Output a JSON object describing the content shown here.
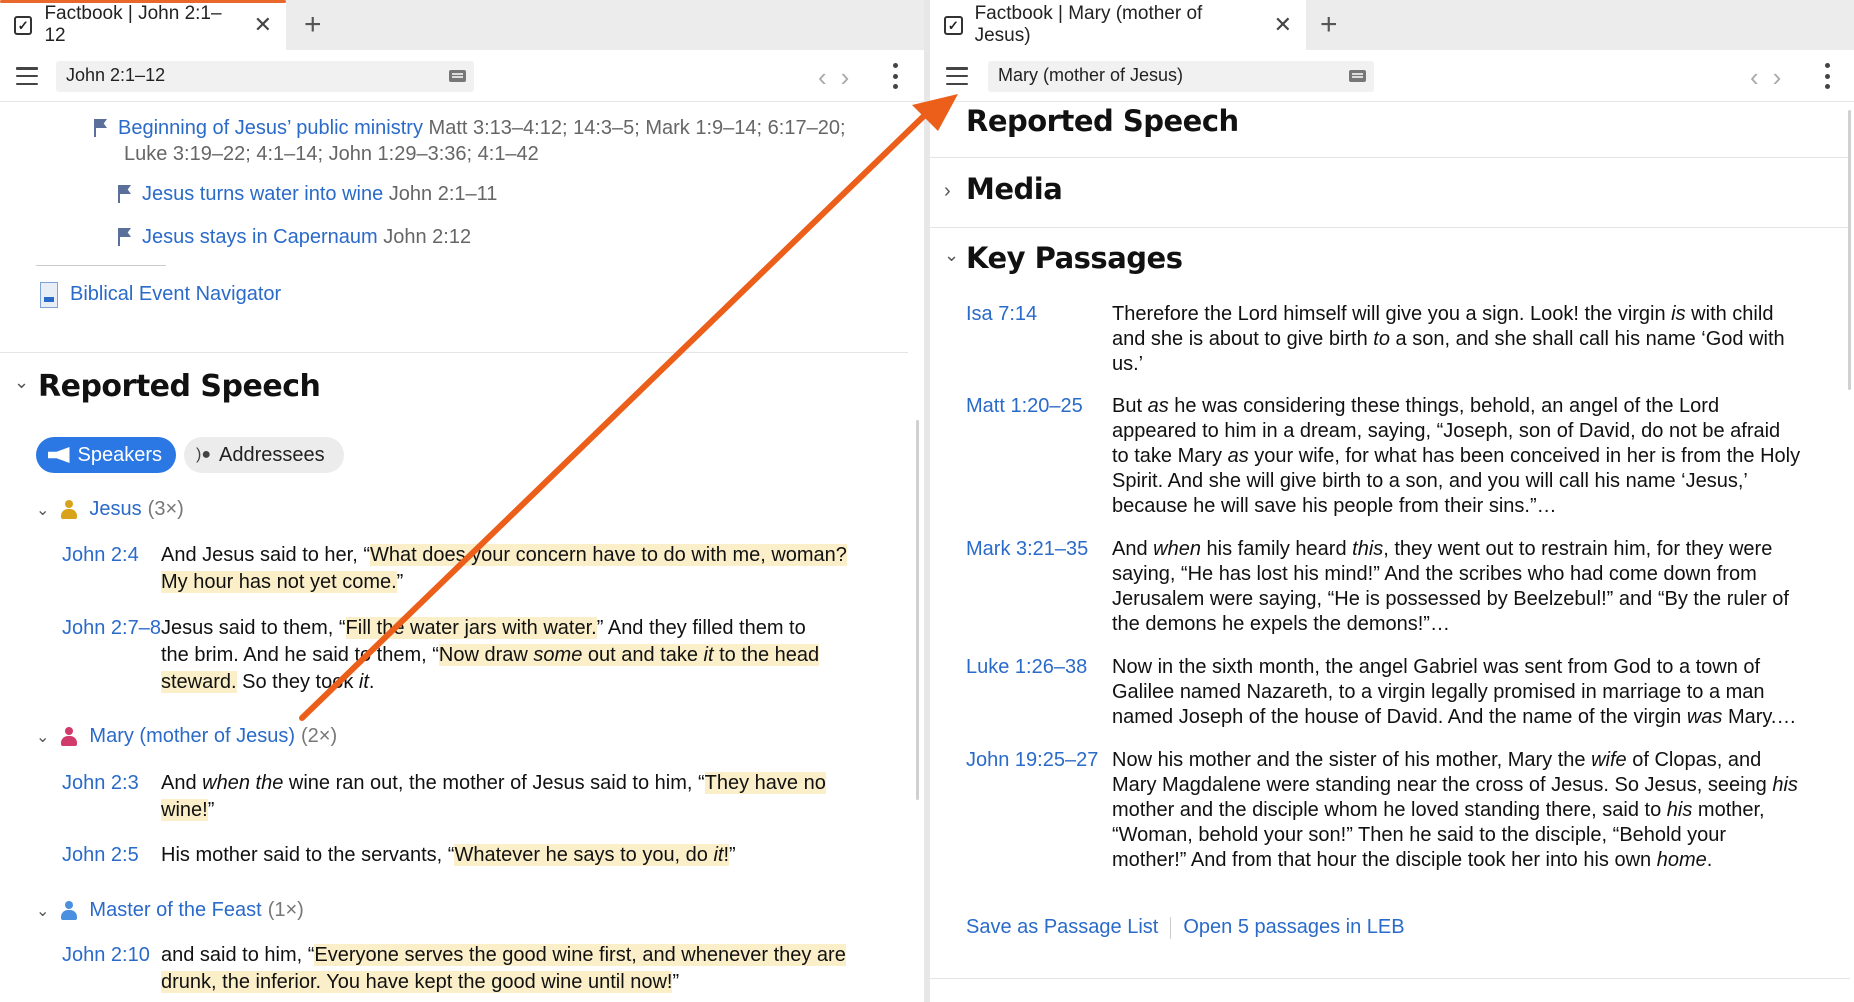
{
  "left": {
    "tab": {
      "title": "Factbook | John 2:1–12"
    },
    "toolbar": {
      "reference": "John 2:1–12"
    },
    "events": [
      {
        "title": "Beginning of Jesus’ public ministry",
        "refs_line1": "Matt 3:13–4:12; 14:3–5; Mark 1:9–14; 6:17–20;",
        "refs_line2": "Luke 3:19–22; 4:1–14; John 1:29–3:36; 4:1–42"
      },
      {
        "title": "Jesus turns water into wine",
        "refs": "John 2:1–11"
      },
      {
        "title": "Jesus stays in Capernaum",
        "refs": "John 2:12"
      }
    ],
    "navigator_link": "Biblical Event Navigator",
    "section_title": "Reported Speech",
    "pills": {
      "speakers": "Speakers",
      "addressees": "Addressees"
    },
    "speakers": [
      {
        "name": "Jesus",
        "count": "(3×)",
        "color": "#d9a21b"
      },
      {
        "name": "Mary (mother of Jesus)",
        "count": "(2×)",
        "color": "#d23a6b"
      },
      {
        "name": "Master of the Feast",
        "count": "(1×)",
        "color": "#4a8fe0"
      }
    ],
    "quotes": {
      "q1": {
        "ref": "John 2:4",
        "a": "And Jesus said to her, “",
        "h1": "What does your concern have to do with me, woman?",
        "h2": "My hour has not yet come.",
        "b": "”"
      },
      "q2": {
        "ref": "John 2:7–8",
        "a": "Jesus said to them, “",
        "h1": "Fill the water jars with water.",
        "b": "” And they filled them to",
        "c": "the brim. And he said to them, “",
        "h2a": "Now draw ",
        "h2b": "some",
        "h2c": " out and take ",
        "h2d": "it",
        "h2e": " to the head",
        "h3": "steward.",
        "d": " So they took ",
        "e": "it",
        "f": "."
      },
      "q3": {
        "ref": "John 2:3",
        "a": "And ",
        "a_i": "when the",
        "b": " wine ran out, the mother of Jesus said to him, “",
        "h1": "They have no",
        "h2": "wine!",
        "c": "”"
      },
      "q4": {
        "ref": "John 2:5",
        "a": "His mother said to the servants, “",
        "h1": "Whatever he says to you, do ",
        "h1_i": "it",
        "h1b": "!",
        "b": "”"
      },
      "q5": {
        "ref": "John 2:10",
        "a": "and said to him, “",
        "h1": "Everyone serves the good wine first, and whenever they are",
        "h2": "drunk, the inferior. You have kept the good wine until now!",
        "b": "”"
      }
    }
  },
  "right": {
    "tab": {
      "title": "Factbook | Mary (mother of Jesus)"
    },
    "toolbar": {
      "reference": "Mary (mother of Jesus)"
    },
    "reported_speech_title": "Reported Speech",
    "media_title": "Media",
    "key_passages_title": "Key Passages",
    "passages": [
      {
        "ref": "Isa 7:14"
      },
      {
        "ref": "Matt 1:20–25"
      },
      {
        "ref": "Mark 3:21–35"
      },
      {
        "ref": "Luke 1:26–38"
      },
      {
        "ref": "John 19:25–27"
      }
    ],
    "passage_texts": {
      "p0": {
        "l1a": "Therefore the Lord himself will give you a sign. Look! the virgin ",
        "l1i": "is",
        "l1b": " with child",
        "l2a": "and she is about to give birth ",
        "l2i": "to",
        "l2b": " a son, and she shall call his name ‘God with",
        "l3": "us.’"
      },
      "p1": {
        "l1a": "But ",
        "l1i": "as",
        "l1b": " he was considering these things, behold, an angel of the Lord",
        "l2": "appeared to him in a dream, saying, “Joseph, son of David, do not be afraid",
        "l3a": "to take Mary ",
        "l3i": "as",
        "l3b": " your wife, for what has been conceived in her is from the Holy",
        "l4": "Spirit. And she will give birth to a son, and you will call his name ‘Jesus,’",
        "l5": "because he will save his people from their sins.”…"
      },
      "p2": {
        "l1a": "And ",
        "l1i": "when",
        "l1b": " his family heard ",
        "l1i2": "this",
        "l1c": ", they went out to restrain him, for they were",
        "l2": "saying, “He has lost his mind!” And the scribes who had come down from",
        "l3": "Jerusalem were saying, “He is possessed by Beelzebul!” and “By the ruler of",
        "l4": "the demons he expels the demons!”…"
      },
      "p3": {
        "l1": "Now in the sixth month, the angel Gabriel was sent from God to a town of",
        "l2": "Galilee named Nazareth, to a virgin legally promised in marriage to a man",
        "l3a": "named Joseph of the house of David. And the name of the virgin ",
        "l3i": "was",
        "l3b": " Mary.…"
      },
      "p4": {
        "l1a": "Now his mother and the sister of his mother, Mary the ",
        "l1i": "wife",
        "l1b": " of Clopas, and",
        "l2a": "Mary Magdalene were standing near the cross of Jesus. So Jesus, seeing ",
        "l2i": "his",
        "l3a": "mother and the disciple whom he loved standing there, said to ",
        "l3i": "his",
        "l3b": " mother,",
        "l4": "“Woman, behold your son!” Then he said to the disciple, “Behold your",
        "l5a": "mother!” And from that hour the disciple took her into his own ",
        "l5i": "home",
        "l5b": "."
      }
    },
    "footer": {
      "save": "Save as Passage List",
      "open": "Open 5 passages in LEB"
    }
  },
  "colors": {
    "accent": "#e8672a",
    "link": "#2a6ac8",
    "highlight": "#fbefc9",
    "pill_active": "#2b78e4",
    "arrow": "#ec5f1a"
  }
}
